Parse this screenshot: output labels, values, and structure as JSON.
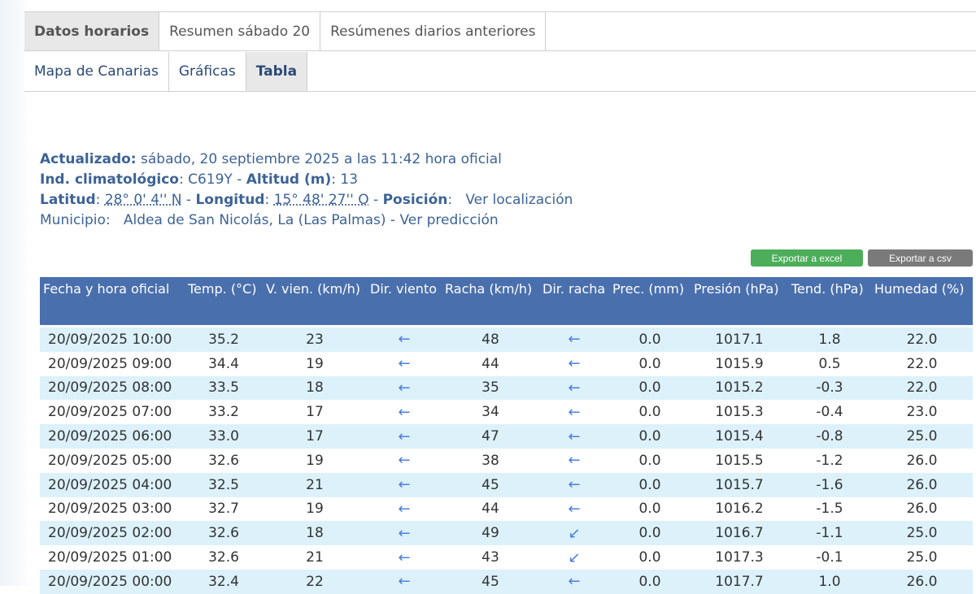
{
  "tabs_primary": [
    {
      "label": "Datos horarios",
      "active": true
    },
    {
      "label": "Resumen sábado 20",
      "active": false
    },
    {
      "label": "Resúmenes diarios anteriores",
      "active": false
    }
  ],
  "tabs_secondary": [
    {
      "label": "Mapa de Canarias",
      "active": false
    },
    {
      "label": "Gráficas",
      "active": false
    },
    {
      "label": "Tabla",
      "active": true
    }
  ],
  "station": {
    "updated_label": "Actualizado:",
    "updated_value": "sábado, 20 septiembre 2025 a las 11:42 hora oficial",
    "ind_label": "Ind. climatológico",
    "ind_value": "C619Y",
    "alt_label": "Altitud (m)",
    "alt_value": "13",
    "lat_label": "Latitud",
    "lat_value": "28° 0' 4'' N",
    "lon_label": "Longitud",
    "lon_value": "15° 48' 27'' O",
    "pos_label": "Posición",
    "pos_link": "Ver localización",
    "mun_label": "Municipio",
    "mun_value": "Aldea de San Nicolás, La (Las Palmas)",
    "mun_link": "Ver predicción"
  },
  "buttons": {
    "excel": "Exportar a excel",
    "csv": "Exportar a csv"
  },
  "table": {
    "headers": [
      "Fecha y hora oficial",
      "Temp. (°C)",
      "V. vien. (km/h)",
      "Dir. viento",
      "Racha (km/h)",
      "Dir. racha",
      "Prec. (mm)",
      "Presión (hPa)",
      "Tend. (hPa)",
      "Humedad (%)"
    ],
    "rows": [
      [
        "20/09/2025 10:00",
        "35.2",
        "23",
        "←",
        "48",
        "←",
        "0.0",
        "1017.1",
        "1.8",
        "22.0"
      ],
      [
        "20/09/2025 09:00",
        "34.4",
        "19",
        "←",
        "44",
        "←",
        "0.0",
        "1015.9",
        "0.5",
        "22.0"
      ],
      [
        "20/09/2025 08:00",
        "33.5",
        "18",
        "←",
        "35",
        "←",
        "0.0",
        "1015.2",
        "-0.3",
        "22.0"
      ],
      [
        "20/09/2025 07:00",
        "33.2",
        "17",
        "←",
        "34",
        "←",
        "0.0",
        "1015.3",
        "-0.4",
        "23.0"
      ],
      [
        "20/09/2025 06:00",
        "33.0",
        "17",
        "←",
        "47",
        "←",
        "0.0",
        "1015.4",
        "-0.8",
        "25.0"
      ],
      [
        "20/09/2025 05:00",
        "32.6",
        "19",
        "←",
        "38",
        "←",
        "0.0",
        "1015.5",
        "-1.2",
        "26.0"
      ],
      [
        "20/09/2025 04:00",
        "32.5",
        "21",
        "←",
        "45",
        "←",
        "0.0",
        "1015.7",
        "-1.6",
        "26.0"
      ],
      [
        "20/09/2025 03:00",
        "32.7",
        "19",
        "←",
        "44",
        "←",
        "0.0",
        "1016.2",
        "-1.5",
        "26.0"
      ],
      [
        "20/09/2025 02:00",
        "32.6",
        "18",
        "←",
        "49",
        "↙",
        "0.0",
        "1016.7",
        "-1.1",
        "25.0"
      ],
      [
        "20/09/2025 01:00",
        "32.6",
        "21",
        "←",
        "43",
        "↙",
        "0.0",
        "1017.3",
        "-0.1",
        "25.0"
      ],
      [
        "20/09/2025 00:00",
        "32.4",
        "22",
        "←",
        "45",
        "←",
        "0.0",
        "1017.7",
        "1.0",
        "26.0"
      ]
    ]
  },
  "colors": {
    "header_bg": "#4a6fad",
    "row_alt": "#dcf1fa",
    "link": "#3d6396",
    "excel": "#4cae5a",
    "csv": "#7a7a7a"
  }
}
